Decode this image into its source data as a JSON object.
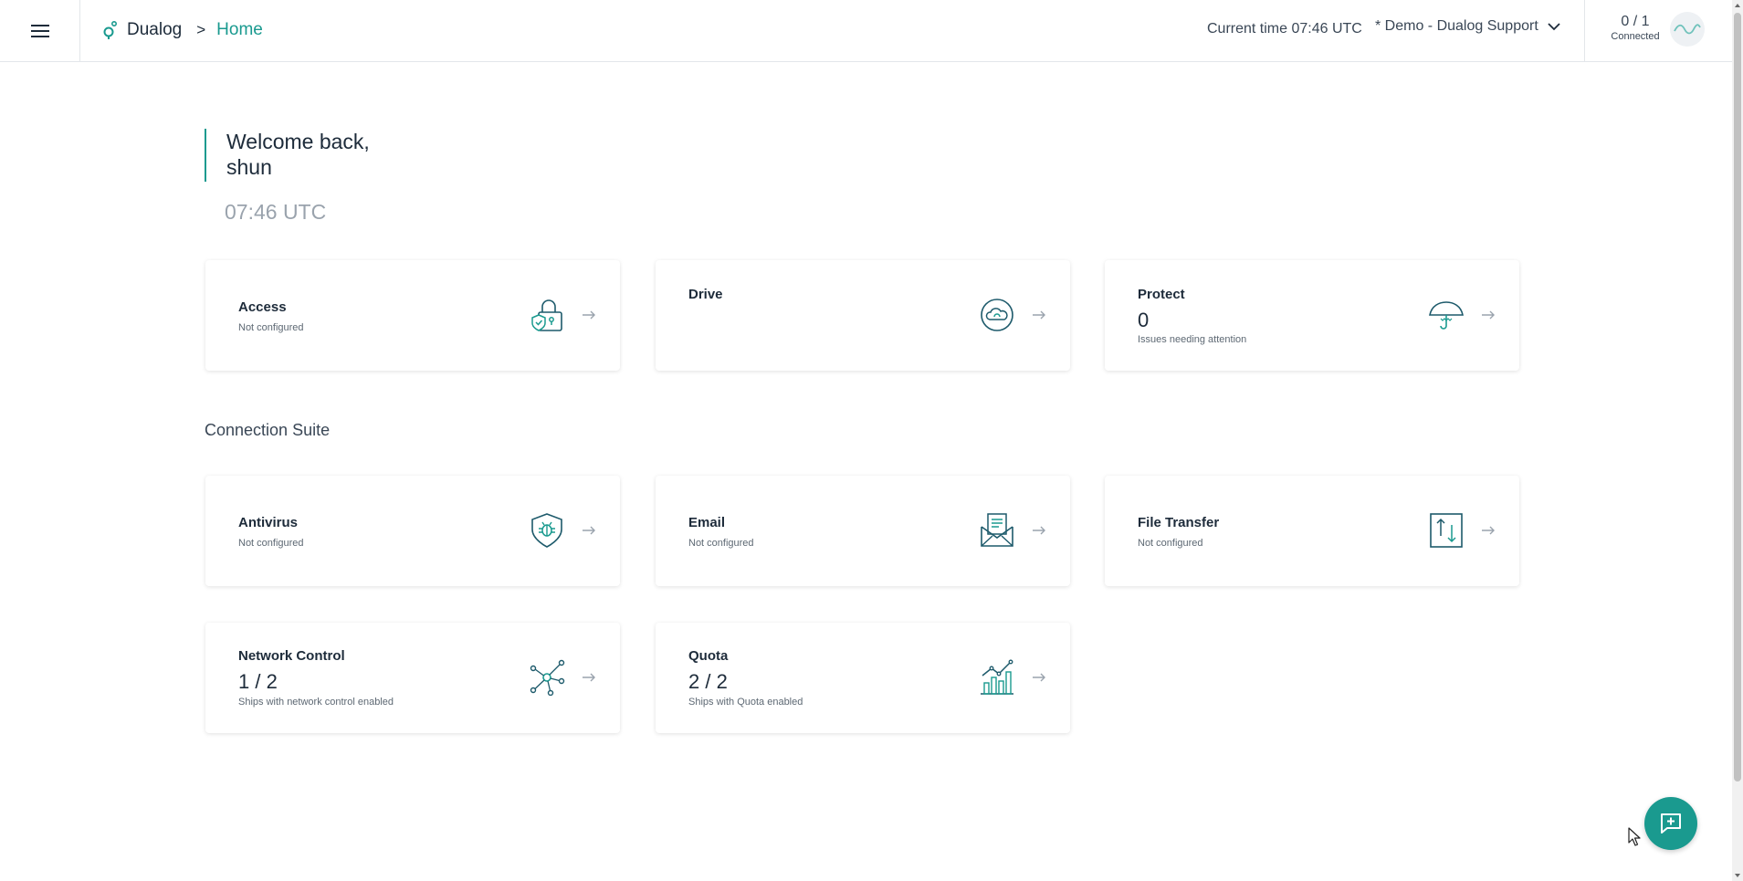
{
  "header": {
    "brand": "Dualog",
    "breadcrumb_sep": ">",
    "breadcrumb_current": "Home",
    "current_time": "Current time 07:46 UTC",
    "org_selector": "* Demo - Dualog Support",
    "connected_count": "0 / 1",
    "connected_label": "Connected"
  },
  "welcome": {
    "line1": "Welcome back,",
    "line2": "shun",
    "time": "07:46 UTC"
  },
  "top_cards": [
    {
      "title": "Access",
      "subtitle": "Not configured",
      "icon": "lock-shield-icon"
    },
    {
      "title": "Drive",
      "subtitle": "",
      "icon": "cloud-icon"
    },
    {
      "title": "Protect",
      "value": "0",
      "subtitle": "Issues needing attention",
      "icon": "umbrella-icon"
    }
  ],
  "section_title": "Connection Suite",
  "suite_cards": [
    {
      "title": "Antivirus",
      "subtitle": "Not configured",
      "icon": "bug-shield-icon"
    },
    {
      "title": "Email",
      "subtitle": "Not configured",
      "icon": "envelope-icon"
    },
    {
      "title": "File Transfer",
      "subtitle": "Not configured",
      "icon": "transfer-icon"
    },
    {
      "title": "Network Control",
      "value": "1 / 2",
      "subtitle": "Ships with network control enabled",
      "icon": "network-icon"
    },
    {
      "title": "Quota",
      "value": "2 / 2",
      "subtitle": "Ships with Quota enabled",
      "icon": "chart-icon"
    }
  ],
  "colors": {
    "accent": "#1a9a8f",
    "text": "#1d2b3a",
    "muted": "#9aa3ad"
  }
}
